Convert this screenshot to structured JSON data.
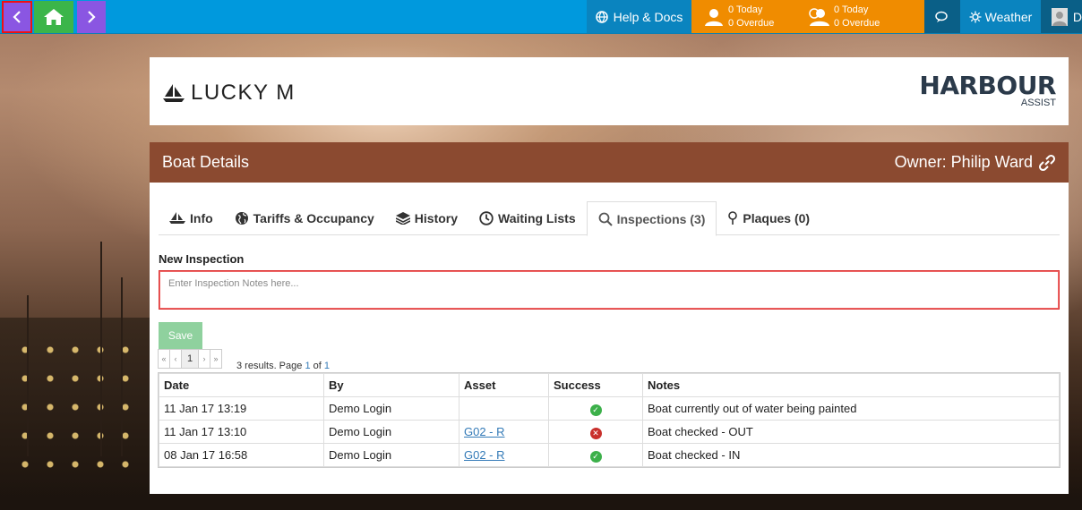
{
  "topbar": {
    "help_label": "Help & Docs",
    "tasks_personal": {
      "today": "0 Today",
      "overdue": "0 Overdue"
    },
    "tasks_team": {
      "today": "0 Today",
      "overdue": "0 Overdue"
    },
    "weather_label": "Weather",
    "user_initial": "D"
  },
  "boat": {
    "name": "LUCKY M"
  },
  "logo": {
    "main": "HARBOUR",
    "sub": "ASSIST"
  },
  "details": {
    "title": "Boat Details",
    "owner": "Owner: Philip Ward"
  },
  "tabs": [
    {
      "label": "Info",
      "icon": "boat-icon"
    },
    {
      "label": "Tariffs & Occupancy",
      "icon": "globe-icon"
    },
    {
      "label": "History",
      "icon": "layers-icon"
    },
    {
      "label": "Waiting Lists",
      "icon": "clock-icon"
    },
    {
      "label": "Inspections (3)",
      "icon": "search-icon",
      "active": true
    },
    {
      "label": "Plaques (0)",
      "icon": "pin-icon"
    }
  ],
  "inspection": {
    "new_label": "New Inspection",
    "placeholder": "Enter Inspection Notes here...",
    "save_label": "Save"
  },
  "pager": {
    "first": "«",
    "prev": "‹",
    "page": "1",
    "next": "›",
    "last": "»",
    "results_text": "3 results. Page",
    "current": "1",
    "of": "of",
    "total": "1"
  },
  "table": {
    "headers": [
      "Date",
      "By",
      "Asset",
      "Success",
      "Notes"
    ],
    "rows": [
      {
        "date": "11 Jan 17 13:19",
        "by": "Demo Login",
        "asset": "",
        "success": true,
        "notes": "Boat currently out of water being painted"
      },
      {
        "date": "11 Jan 17 13:10",
        "by": "Demo Login",
        "asset": "G02 - R",
        "success": false,
        "notes": "Boat checked - OUT"
      },
      {
        "date": "08 Jan 17 16:58",
        "by": "Demo Login",
        "asset": "G02 - R",
        "success": true,
        "notes": "Boat checked - IN"
      }
    ]
  },
  "colors": {
    "topbar": "#0099dd",
    "orange": "#f08c00",
    "header": "#8b4a30",
    "success": "#3cb04a",
    "fail": "#c9302c"
  }
}
